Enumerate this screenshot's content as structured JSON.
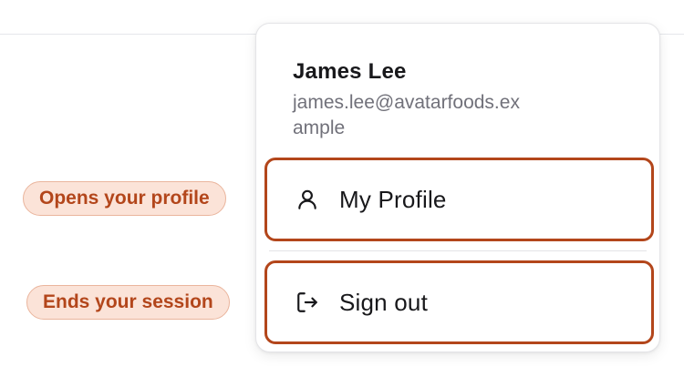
{
  "user": {
    "name": "James Lee",
    "email": "james.lee@avatarfoods.example"
  },
  "menu": {
    "items": [
      {
        "label": "My Profile",
        "icon": "user-icon"
      },
      {
        "label": "Sign out",
        "icon": "sign-out-icon"
      }
    ]
  },
  "callouts": {
    "profile": "Opens your profile",
    "signout": "Ends your session"
  },
  "colors": {
    "accent": "#b3461b",
    "callout_bg": "#fbe3d8",
    "text_primary": "#18181b",
    "text_secondary": "#71717a"
  }
}
